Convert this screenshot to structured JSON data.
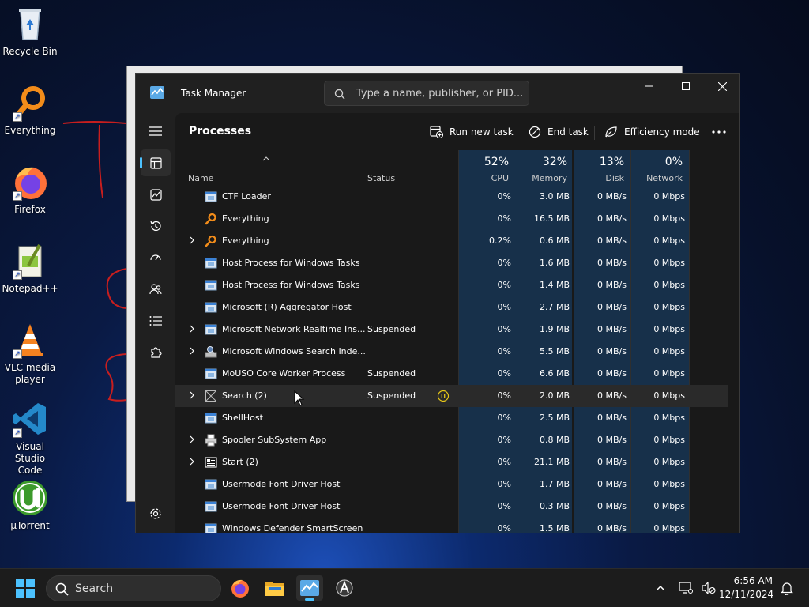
{
  "desktop": {
    "icons": [
      {
        "label": "Recycle Bin",
        "icon": "recycle-bin-icon"
      },
      {
        "label": "Everything",
        "icon": "everything-icon"
      },
      {
        "label": "Firefox",
        "icon": "firefox-icon"
      },
      {
        "label": "Notepad++",
        "icon": "notepadpp-icon"
      },
      {
        "label": "VLC media player",
        "icon": "vlc-icon"
      },
      {
        "label": "Visual Studio Code",
        "icon": "vscode-icon"
      },
      {
        "label": "µTorrent",
        "icon": "utorrent-icon"
      }
    ]
  },
  "task_manager": {
    "title": "Task Manager",
    "search_placeholder": "Type a name, publisher, or PID...",
    "page_title": "Processes",
    "toolbar": {
      "run_new_task": "Run new task",
      "end_task": "End task",
      "efficiency_mode": "Efficiency mode"
    },
    "columns": {
      "name": "Name",
      "status": "Status",
      "cpu_pct": "52%",
      "cpu": "CPU",
      "memory_pct": "32%",
      "memory": "Memory",
      "disk_pct": "13%",
      "disk": "Disk",
      "network_pct": "0%",
      "network": "Network"
    },
    "processes": [
      {
        "name": "CTF Loader",
        "status": "",
        "cpu": "0%",
        "memory": "3.0 MB",
        "disk": "0 MB/s",
        "network": "0 Mbps",
        "expandable": false,
        "icon": "window-icon"
      },
      {
        "name": "Everything",
        "status": "",
        "cpu": "0%",
        "memory": "16.5 MB",
        "disk": "0 MB/s",
        "network": "0 Mbps",
        "expandable": false,
        "icon": "everything-icon"
      },
      {
        "name": "Everything",
        "status": "",
        "cpu": "0.2%",
        "memory": "0.6 MB",
        "disk": "0 MB/s",
        "network": "0 Mbps",
        "expandable": true,
        "icon": "everything-icon"
      },
      {
        "name": "Host Process for Windows Tasks",
        "status": "",
        "cpu": "0%",
        "memory": "1.6 MB",
        "disk": "0 MB/s",
        "network": "0 Mbps",
        "expandable": false,
        "icon": "window-icon"
      },
      {
        "name": "Host Process for Windows Tasks",
        "status": "",
        "cpu": "0%",
        "memory": "1.4 MB",
        "disk": "0 MB/s",
        "network": "0 Mbps",
        "expandable": false,
        "icon": "window-icon"
      },
      {
        "name": "Microsoft (R) Aggregator Host",
        "status": "",
        "cpu": "0%",
        "memory": "2.7 MB",
        "disk": "0 MB/s",
        "network": "0 Mbps",
        "expandable": false,
        "icon": "window-icon"
      },
      {
        "name": "Microsoft Network Realtime Ins...",
        "status": "Suspended",
        "cpu": "0%",
        "memory": "1.9 MB",
        "disk": "0 MB/s",
        "network": "0 Mbps",
        "expandable": true,
        "icon": "window-icon"
      },
      {
        "name": "Microsoft Windows Search Inde...",
        "status": "",
        "cpu": "0%",
        "memory": "5.5 MB",
        "disk": "0 MB/s",
        "network": "0 Mbps",
        "expandable": true,
        "icon": "search-indexer-icon"
      },
      {
        "name": "MoUSO Core Worker Process",
        "status": "Suspended",
        "cpu": "0%",
        "memory": "6.6 MB",
        "disk": "0 MB/s",
        "network": "0 Mbps",
        "expandable": false,
        "icon": "window-icon"
      },
      {
        "name": "Search (2)",
        "status": "Suspended",
        "cpu": "0%",
        "memory": "2.0 MB",
        "disk": "0 MB/s",
        "network": "0 Mbps",
        "expandable": true,
        "icon": "search-app-icon",
        "paused_indicator": true
      },
      {
        "name": "ShellHost",
        "status": "",
        "cpu": "0%",
        "memory": "2.5 MB",
        "disk": "0 MB/s",
        "network": "0 Mbps",
        "expandable": false,
        "icon": "window-icon"
      },
      {
        "name": "Spooler SubSystem App",
        "status": "",
        "cpu": "0%",
        "memory": "0.8 MB",
        "disk": "0 MB/s",
        "network": "0 Mbps",
        "expandable": true,
        "icon": "printer-icon"
      },
      {
        "name": "Start (2)",
        "status": "",
        "cpu": "0%",
        "memory": "21.1 MB",
        "disk": "0 MB/s",
        "network": "0 Mbps",
        "expandable": true,
        "icon": "start-app-icon"
      },
      {
        "name": "Usermode Font Driver Host",
        "status": "",
        "cpu": "0%",
        "memory": "1.7 MB",
        "disk": "0 MB/s",
        "network": "0 Mbps",
        "expandable": false,
        "icon": "window-icon"
      },
      {
        "name": "Usermode Font Driver Host",
        "status": "",
        "cpu": "0%",
        "memory": "0.3 MB",
        "disk": "0 MB/s",
        "network": "0 Mbps",
        "expandable": false,
        "icon": "window-icon"
      },
      {
        "name": "Windows Defender SmartScreen",
        "status": "",
        "cpu": "0%",
        "memory": "1.5 MB",
        "disk": "0 MB/s",
        "network": "0 Mbps",
        "expandable": false,
        "icon": "window-icon"
      }
    ]
  },
  "taskbar": {
    "search_label": "Search",
    "time": "6:56 AM",
    "date": "12/11/2024"
  },
  "colors": {
    "accent": "#4cc2ff",
    "heat": "#17304a",
    "suspended_indicator": "#e6c619"
  }
}
